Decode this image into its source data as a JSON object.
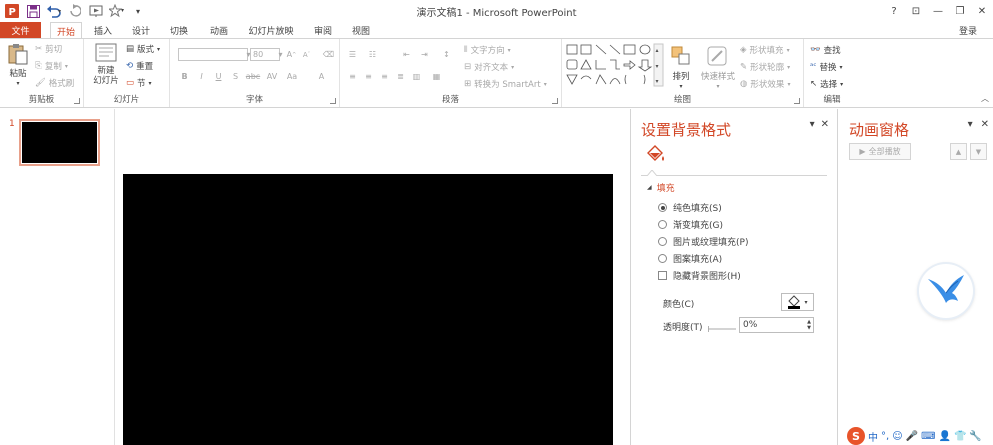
{
  "window": {
    "title": "演示文稿1 - Microsoft PowerPoint",
    "controls": [
      "?",
      "⊡",
      "—",
      "❐",
      "✕"
    ]
  },
  "qat": {
    "items": [
      "powerpoint-logo-icon",
      "save-icon",
      "undo-icon",
      "redo-icon",
      "start-from-beginning-icon",
      "star-icon",
      "customize-qat-icon"
    ]
  },
  "tabs": {
    "file": "文件",
    "items": [
      "开始",
      "插入",
      "设计",
      "切换",
      "动画",
      "幻灯片放映",
      "审阅",
      "视图"
    ],
    "active": "开始",
    "login": "登录"
  },
  "ribbon": {
    "clipboard": {
      "label": "剪贴板",
      "paste": "粘贴",
      "cut": "剪切",
      "copy": "复制",
      "format_painter": "格式刷"
    },
    "slides": {
      "label": "幻灯片",
      "new_slide_line1": "新建",
      "new_slide_line2": "幻灯片",
      "layout": "版式",
      "reset": "重置",
      "section": "节"
    },
    "font": {
      "label": "字体",
      "font_name_value": "",
      "font_size_value": "80",
      "bold": "B",
      "italic": "I",
      "underline": "U",
      "shadow": "S",
      "strike": "abc",
      "spacing": "AV",
      "case": "Aa",
      "color": "A",
      "grow": "A",
      "shrink": "A"
    },
    "paragraph": {
      "label": "段落",
      "text_direction": "文字方向",
      "align_text": "对齐文本",
      "smartart": "转换为 SmartArt"
    },
    "drawing": {
      "label": "绘图",
      "arrange": "排列",
      "quick_styles": "快速样式",
      "shape_fill": "形状填充",
      "shape_outline": "形状轮廓",
      "shape_effects": "形状效果"
    },
    "editing": {
      "label": "编辑",
      "find": "查找",
      "replace": "替换",
      "select": "选择"
    }
  },
  "slides": [
    {
      "number": "1"
    }
  ],
  "format_pane": {
    "title": "设置背景格式",
    "section": "填充",
    "fill_options": [
      {
        "label": "纯色填充(S)",
        "checked": true
      },
      {
        "label": "渐变填充(G)",
        "checked": false
      },
      {
        "label": "图片或纹理填充(P)",
        "checked": false
      },
      {
        "label": "图案填充(A)",
        "checked": false
      }
    ],
    "hide_bg_graphics": "隐藏背景图形(H)",
    "color_label": "颜色(C)",
    "transparency_label": "透明度(T)",
    "transparency_value": "0%"
  },
  "anim_pane": {
    "title": "动画窗格",
    "play_all": "全部播放"
  },
  "ime": {
    "items": [
      "中",
      "°,",
      "☺",
      "🎤",
      "⌨",
      "👤",
      "👕",
      "🔧"
    ]
  }
}
